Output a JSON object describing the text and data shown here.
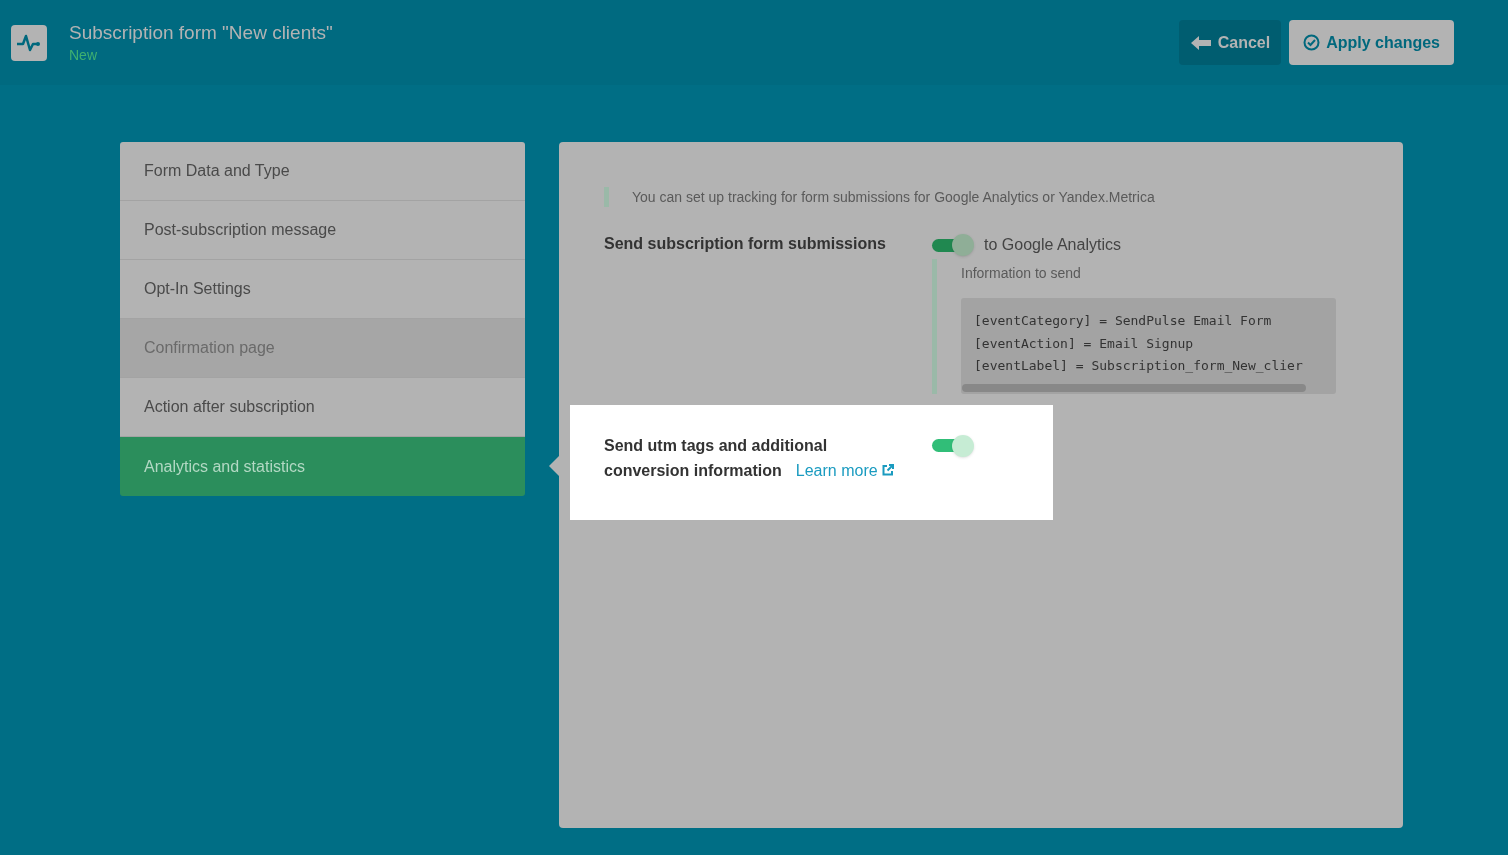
{
  "header": {
    "title": "Subscription form \"New clients\"",
    "status": "New",
    "buttons": [
      {
        "label": "Cancel",
        "kind": "cancel"
      },
      {
        "label": "Apply changes",
        "kind": "apply"
      }
    ]
  },
  "menu": [
    {
      "label": "Form Data and Type",
      "selected": false,
      "hovered": false
    },
    {
      "label": "Post-subscription message",
      "selected": false,
      "hovered": false
    },
    {
      "label": "Opt-In Settings",
      "selected": false,
      "hovered": false
    },
    {
      "label": "Confirmation page",
      "selected": false,
      "hovered": true
    },
    {
      "label": "Action after subscription",
      "selected": false,
      "hovered": false
    },
    {
      "label": "Analytics and statistics",
      "selected": true,
      "hovered": false
    }
  ],
  "panel": {
    "note": "You can set up tracking for form submissions for Google Analytics or Yandex.Metrica",
    "ga": {
      "label": "Send subscription form submissions",
      "on": true,
      "toggle_label": "to Google Analytics",
      "info_label": "Information to send",
      "code_lines": [
        "[eventCategory] = SendPulse Email Form",
        "[eventAction] = Email Signup",
        "[eventLabel] = Subscription_form_New_clier"
      ]
    },
    "utm": {
      "label_line1": "Send utm tags and additional",
      "label_line2": "conversion information",
      "link": "Learn more",
      "on": true
    }
  }
}
